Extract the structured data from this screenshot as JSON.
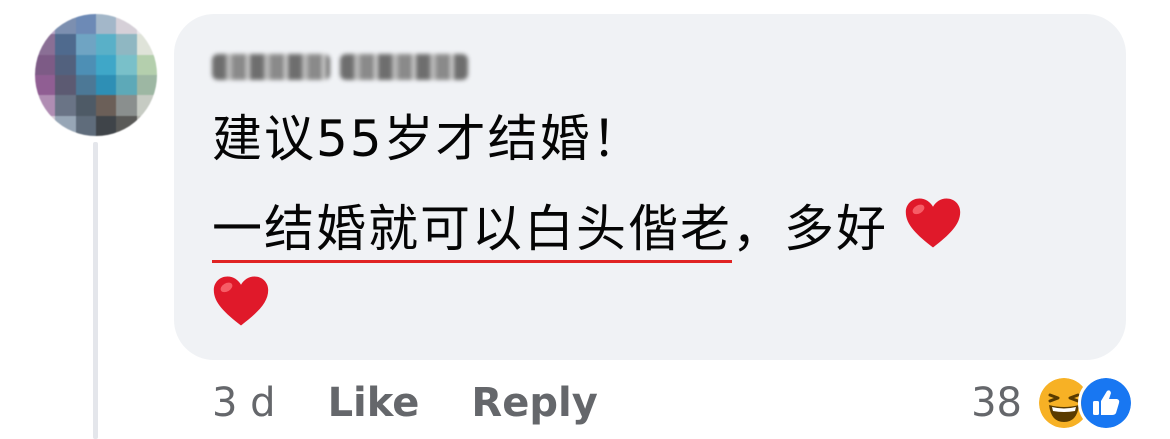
{
  "comment": {
    "author_name": "",
    "text_line1": "建议55岁才结婚！",
    "text_line2_underlined": "一结婚就可以白头偕老",
    "text_line2_rest": "，多好",
    "emoji": "red-heart"
  },
  "meta": {
    "time": "3 d",
    "like_label": "Like",
    "reply_label": "Reply"
  },
  "reactions": {
    "count": "38",
    "icons": [
      "laughing-face-icon",
      "thumbs-up-icon"
    ]
  },
  "colors": {
    "bubble": "#f0f2f5",
    "text": "#050505",
    "meta": "#65676b",
    "underline": "#e02424",
    "like_blue": "#1877f2"
  }
}
